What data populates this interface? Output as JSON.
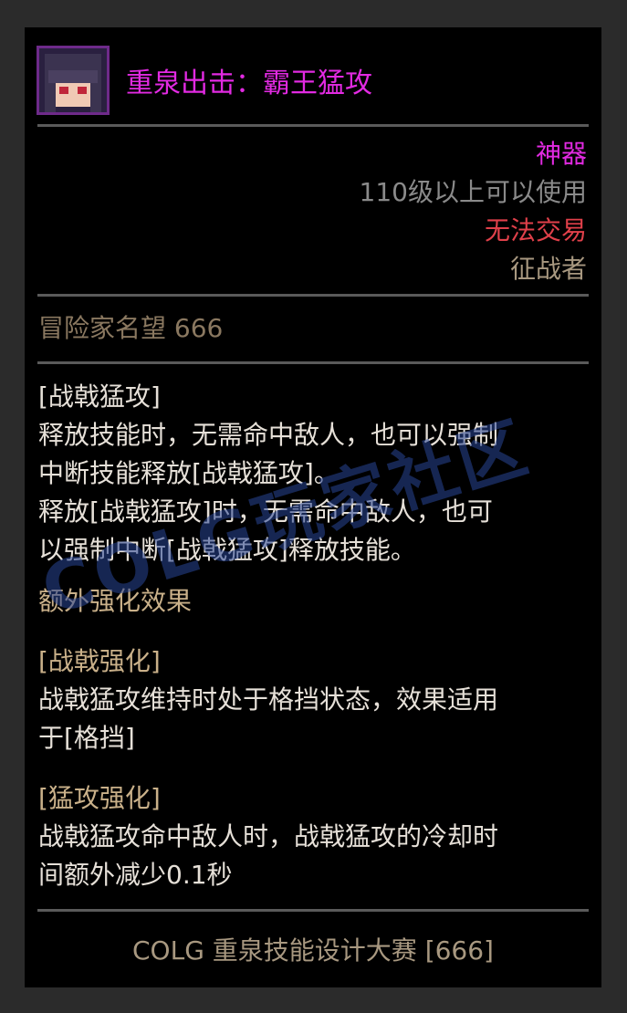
{
  "item": {
    "title": "重泉出击：霸王猛攻",
    "rarity": "神器",
    "level_requirement": "110级以上可以使用",
    "trade_status": "无法交易",
    "job": "征战者",
    "fame": "冒险家名望 666"
  },
  "description": {
    "skill_name": "[战戟猛攻]",
    "lines": [
      "释放技能时，无需命中敌人，也可以强制",
      "中断技能释放[战戟猛攻]。",
      "释放[战戟猛攻]时，无需命中敌人，也可",
      "以强制中断[战戟猛攻]释放技能。"
    ],
    "extra_header": "额外强化效果",
    "enhance1_name": "[战戟强化]",
    "enhance1_lines": [
      "战戟猛攻维持时处于格挡状态，效果适用",
      "于[格挡]"
    ],
    "enhance2_name": "[猛攻强化]",
    "enhance2_lines": [
      "战戟猛攻命中敌人时，战戟猛攻的冷却时",
      "间额外减少0.1秒"
    ]
  },
  "footer": "COLG 重泉技能设计大赛 [666]",
  "watermark": "COLG玩家社区",
  "colors": {
    "epic": "#e22ae2",
    "untradeable": "#e0404a",
    "gold_text": "#c9b089",
    "body_text": "#e6e0d8"
  },
  "icons": {
    "portrait": "character-portrait-icon"
  }
}
